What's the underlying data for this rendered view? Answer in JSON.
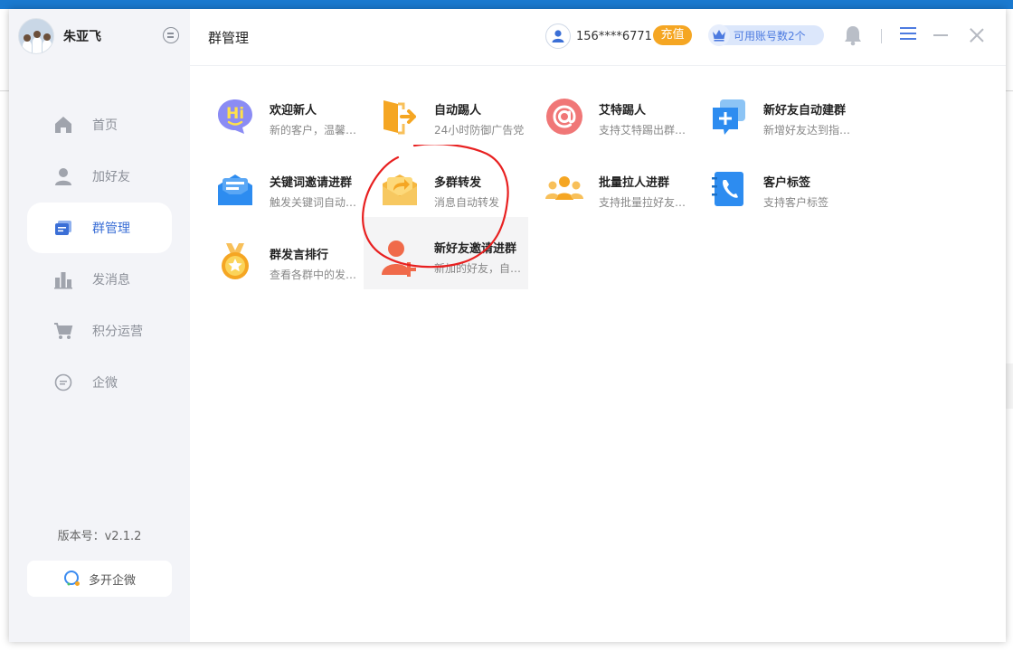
{
  "sidebar": {
    "user_name": "朱亚飞",
    "items": [
      {
        "label": "首页",
        "icon": "home-icon"
      },
      {
        "label": "加好友",
        "icon": "person-icon"
      },
      {
        "label": "群管理",
        "icon": "group-manage-icon",
        "active": true
      },
      {
        "label": "发消息",
        "icon": "bar-chart-icon"
      },
      {
        "label": "积分运营",
        "icon": "cart-icon"
      },
      {
        "label": "企微",
        "icon": "chat-bubble-icon"
      }
    ],
    "version": "版本号：v2.1.2",
    "multi_open_label": "多开企微"
  },
  "header": {
    "title": "群管理",
    "phone": "156****6771",
    "recharge_label": "充值",
    "accounts_label": "可用账号数2个"
  },
  "features": [
    {
      "title": "欢迎新人",
      "desc": "新的客户，温馨提醒",
      "icon": "hi-icon",
      "color": "#8b8cf4"
    },
    {
      "title": "自动踢人",
      "desc": "24小时防御广告党",
      "icon": "exit-door-icon",
      "color": "#f5a623"
    },
    {
      "title": "艾特踢人",
      "desc": "支持艾特踢出群成员",
      "icon": "at-sign-icon",
      "color": "#f07777"
    },
    {
      "title": "新好友自动建群",
      "desc": "新增好友达到指定人数",
      "icon": "new-group-icon",
      "color": "#2d8cf0"
    },
    {
      "title": "关键词邀请进群",
      "desc": "触发关键词自动邀请",
      "icon": "envelope-icon",
      "color": "#2d8cf0"
    },
    {
      "title": "多群转发",
      "desc": "消息自动转发",
      "icon": "forward-box-icon",
      "color": "#f7c04a"
    },
    {
      "title": "批量拉人进群",
      "desc": "支持批量拉好友进群",
      "icon": "people-group-icon",
      "color": "#f5a623"
    },
    {
      "title": "客户标签",
      "desc": "支持客户标签",
      "icon": "contact-book-icon",
      "color": "#2d8cf0"
    },
    {
      "title": "群发言排行",
      "desc": "查看各群中的发言排行",
      "icon": "medal-icon",
      "color": "#f5a623"
    },
    {
      "title": "新好友邀请进群",
      "desc": "新加的好友，自动邀请",
      "icon": "add-person-icon",
      "color": "#f06a4a"
    }
  ],
  "colors": {
    "accent": "#3b6fd6",
    "recharge": "#f5a623",
    "annotation": "#e82020"
  }
}
